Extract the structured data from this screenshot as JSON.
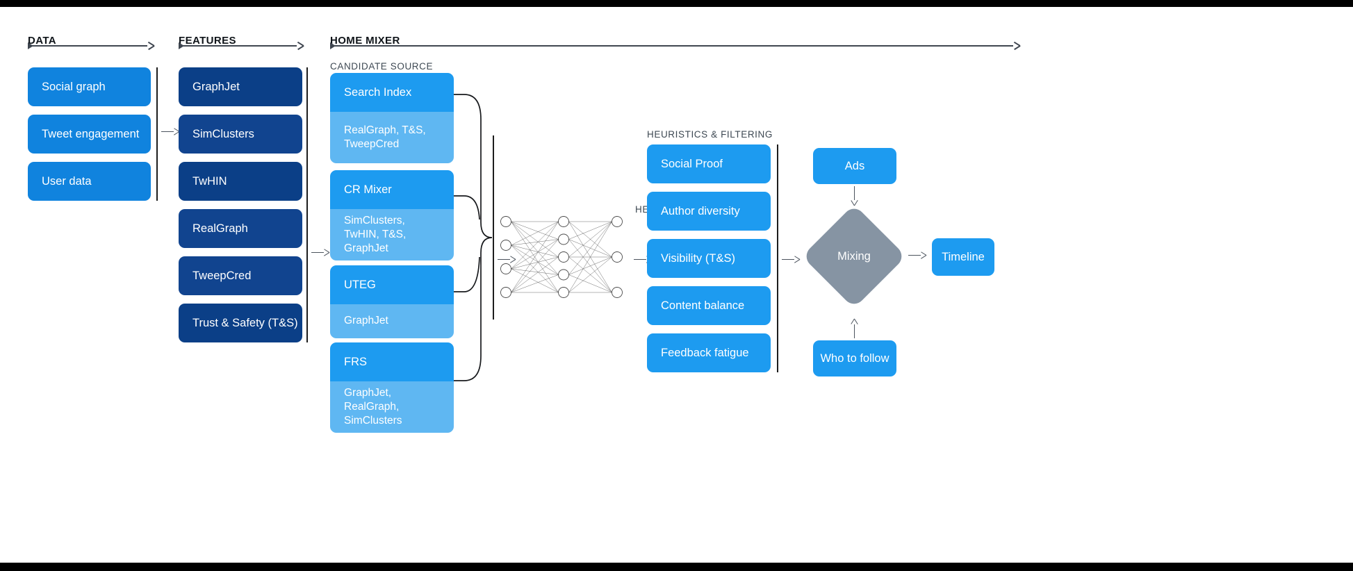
{
  "sections": {
    "data": {
      "title": "DATA"
    },
    "features": {
      "title": "FEATURES"
    },
    "home_mixer": {
      "title": "HOME MIXER"
    },
    "candidate_source": {
      "title": "CANDIDATE SOURCE"
    },
    "heavy_ranker": {
      "title": "HEAVY RANKER"
    },
    "heuristics": {
      "title": "HEURISTICS & FILTERING"
    }
  },
  "data_boxes": [
    {
      "label": "Social graph"
    },
    {
      "label": "Tweet engagement"
    },
    {
      "label": "User data"
    }
  ],
  "feature_boxes": [
    {
      "label": "GraphJet"
    },
    {
      "label": "SimClusters"
    },
    {
      "label": "TwHIN"
    },
    {
      "label": "RealGraph"
    },
    {
      "label": "TweepCred"
    },
    {
      "label": "Trust & Safety (T&S)"
    }
  ],
  "candidate_sources": [
    {
      "name": "Search Index",
      "features": "RealGraph, T&S, TweepCred"
    },
    {
      "name": "CR Mixer",
      "features": "SimClusters, TwHIN, T&S, GraphJet"
    },
    {
      "name": "UTEG",
      "features": "GraphJet"
    },
    {
      "name": "FRS",
      "features": "GraphJet, RealGraph, SimClusters"
    }
  ],
  "heuristics_boxes": [
    {
      "label": "Social Proof"
    },
    {
      "label": "Author diversity"
    },
    {
      "label": "Visibility (T&S)"
    },
    {
      "label": "Content balance"
    },
    {
      "label": "Feedback fatigue"
    }
  ],
  "mixing": {
    "ads_label": "Ads",
    "mixing_label": "Mixing",
    "who_to_follow_label": "Who to follow",
    "timeline_label": "Timeline"
  },
  "neural_net": {
    "input_nodes": 4,
    "hidden_nodes": 5,
    "output_nodes": 3
  },
  "colors": {
    "data_blue": "#1083DE",
    "feature_navy": "#0B3F87",
    "candidate_blue": "#1D9BF0",
    "candidate_blue_light": "#5FB7F2",
    "heuristic_blue": "#1D9BF0",
    "mixing_gray": "#8694A3",
    "background": "#FFFFFF",
    "letterbox": "#000000"
  }
}
